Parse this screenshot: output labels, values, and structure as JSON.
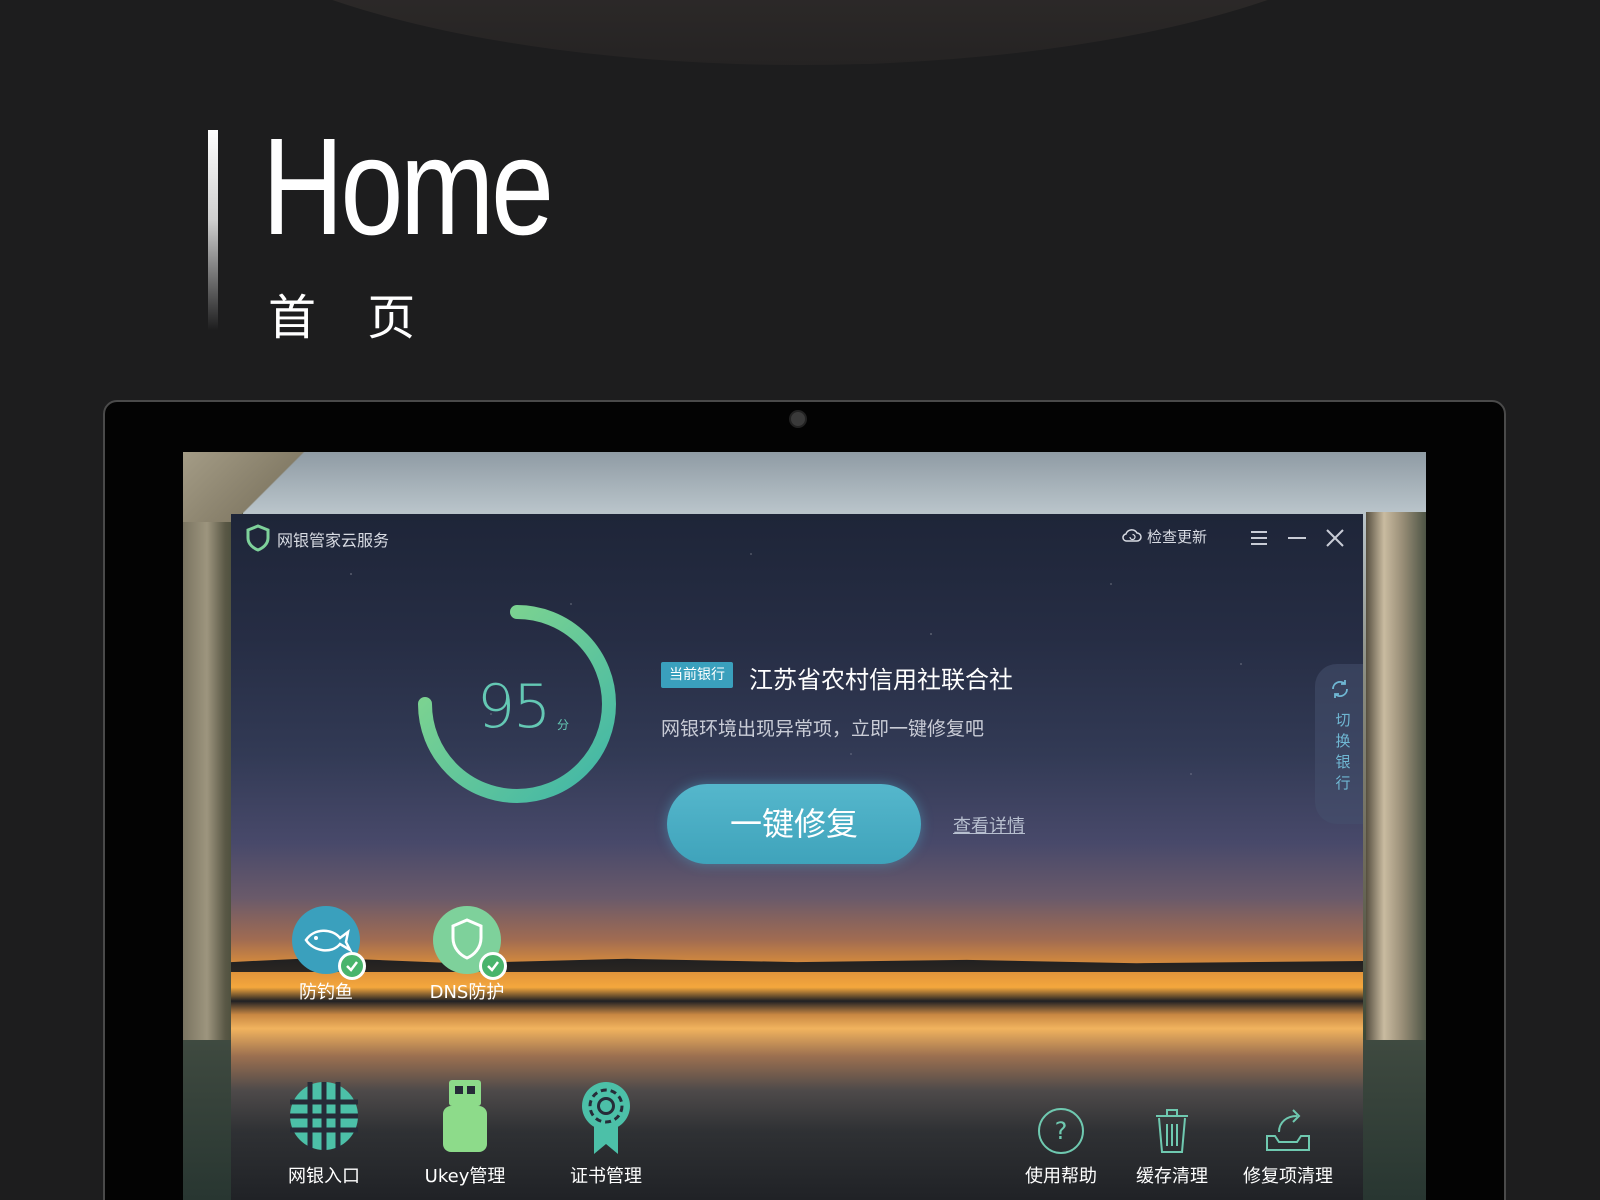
{
  "heading": {
    "en": "Home",
    "cn": "首 页"
  },
  "app": {
    "title": "网银管家云服务",
    "check_update": "检查更新",
    "score": "95",
    "score_unit": "分",
    "bank_tag": "当前银行",
    "bank_name": "江苏省农村信用社联合社",
    "warning": "网银环境出现异常项，立即一键修复吧",
    "fix_button": "一键修复",
    "details_link": "查看详情",
    "switch_bank": "切换银行",
    "protections": [
      {
        "label": "防钓鱼",
        "icon": "fish-icon"
      },
      {
        "label": "DNS防护",
        "icon": "shield-icon"
      }
    ],
    "tools_left": [
      {
        "label": "网银入口",
        "icon": "globe-icon"
      },
      {
        "label": "Ukey管理",
        "icon": "usb-key-icon"
      },
      {
        "label": "证书管理",
        "icon": "certificate-icon"
      }
    ],
    "tools_right": [
      {
        "label": "使用帮助",
        "icon": "help-icon"
      },
      {
        "label": "缓存清理",
        "icon": "trash-icon"
      },
      {
        "label": "修复项清理",
        "icon": "tray-export-icon"
      }
    ]
  },
  "colors": {
    "accent_teal": "#64c8b4",
    "button_blue": "#3fa3bb",
    "ring_green": "#7ed19b",
    "check_green": "#49b46c"
  }
}
